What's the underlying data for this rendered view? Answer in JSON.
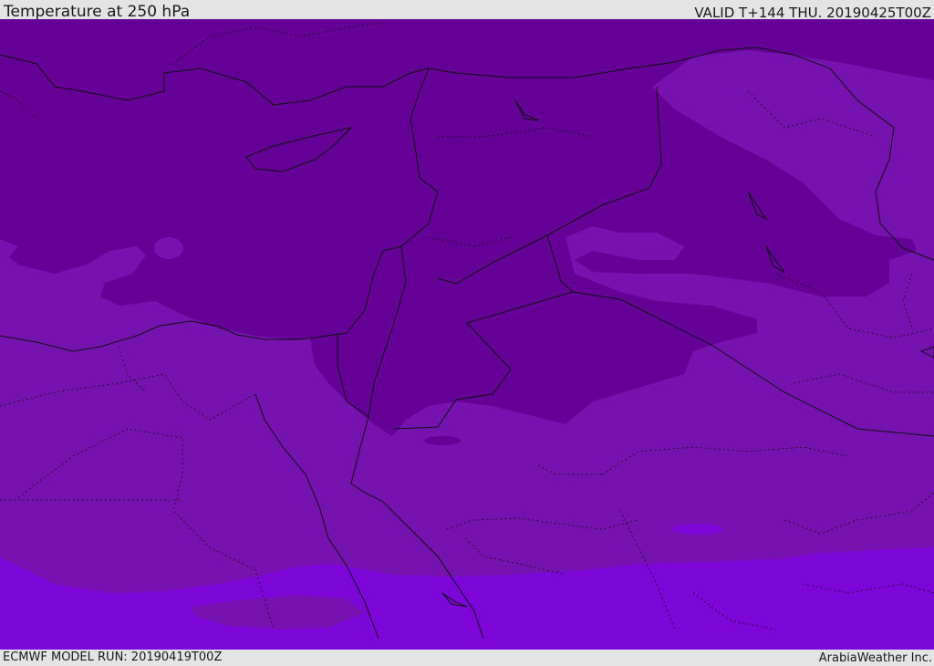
{
  "header": {
    "title": "Temperature at 250 hPa",
    "valid": "VALID T+144 THU. 20190425T00Z"
  },
  "footer": {
    "model_run": "ECMWF MODEL RUN: 20190419T00Z",
    "credit": "ArabiaWeather Inc."
  },
  "colors": {
    "coldest_band": "#640096",
    "cold_band": "#7612b0",
    "mid_band": "#7d06d8",
    "border": "#111111"
  }
}
